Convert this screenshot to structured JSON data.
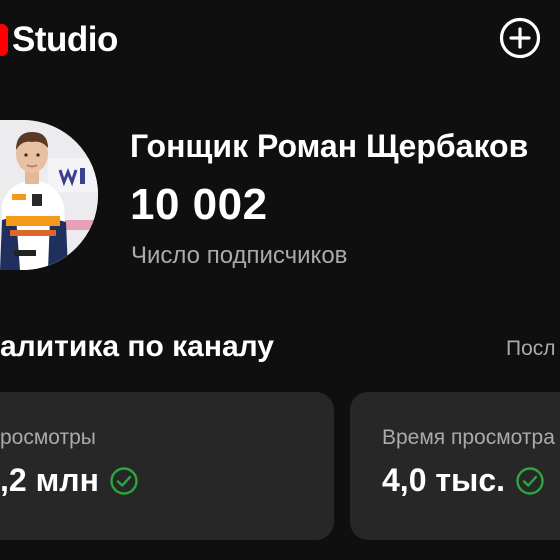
{
  "header": {
    "logo_text": "Studio",
    "logo_icon": "youtube-play-icon",
    "create_icon": "plus-circle-icon"
  },
  "channel": {
    "name": "Гонщик Роман Щербаков",
    "subscriber_count": "10 002",
    "subscriber_label": "Число подписчиков",
    "avatar_icon": "channel-avatar"
  },
  "analytics": {
    "title": "алитика по каналу",
    "link_label": "Посл",
    "cards": [
      {
        "label": "росмотры",
        "value": ",2 млн",
        "status_icon": "check-circle-icon"
      },
      {
        "label": "Время просмотра",
        "value": "4,0 тыс.",
        "status_icon": "check-circle-icon"
      }
    ]
  },
  "colors": {
    "background": "#0f0f0f",
    "card": "#272727",
    "brand_red": "#ff0000",
    "success_green": "#2ba640",
    "secondary_text": "#aaaaaa"
  }
}
